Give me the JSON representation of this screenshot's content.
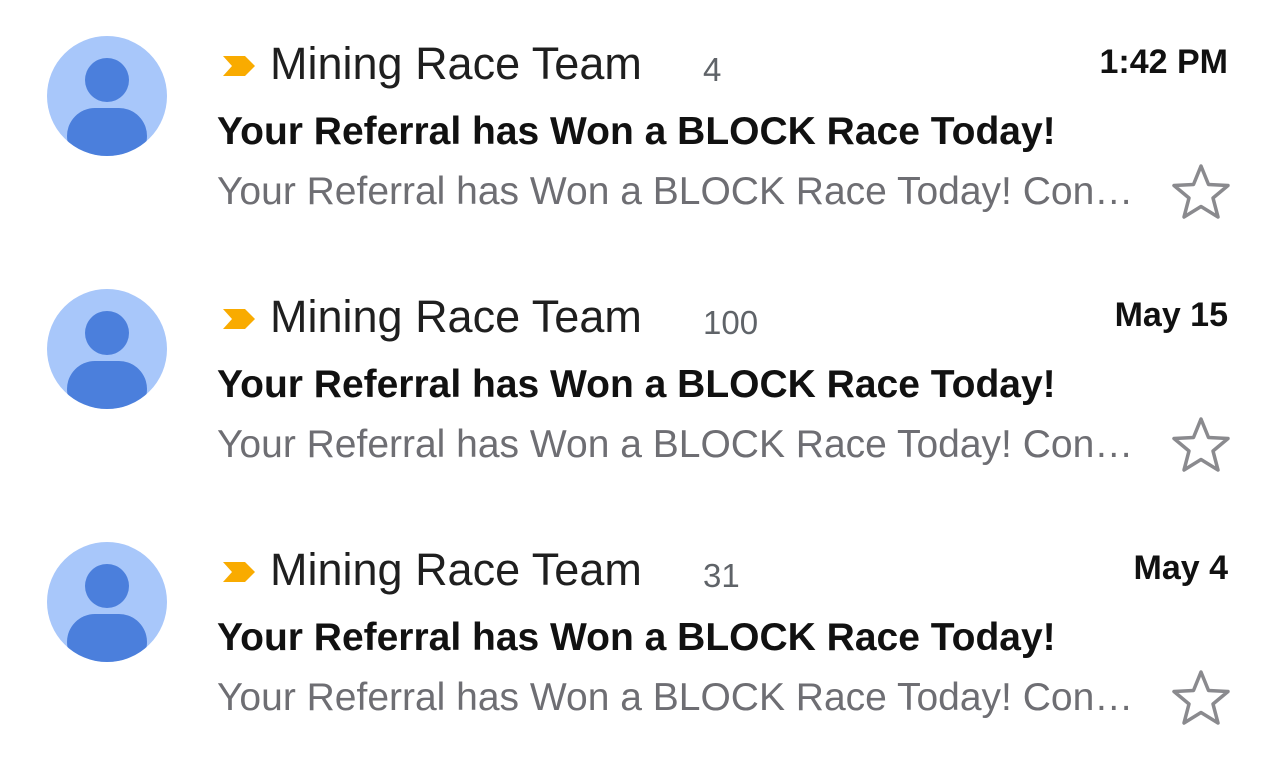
{
  "colors": {
    "avatar_bg": "#a8c7fa",
    "avatar_fg": "#4b7fdc",
    "important_marker": "#f9ab00",
    "star_outline": "#8a8a8e",
    "snippet_text": "#6e6e73",
    "count_text": "#5f6368"
  },
  "icons": {
    "avatar": "person-silhouette-icon",
    "important": "important-marker-icon",
    "star": "star-outline-icon"
  },
  "emails": [
    {
      "sender": "Mining Race Team",
      "count": "4",
      "time": "1:42 PM",
      "subject": "Your Referral has Won a BLOCK Race Today!",
      "snippet": "Your Referral has Won a BLOCK Race Today! Congratulations",
      "starred": false
    },
    {
      "sender": "Mining Race Team",
      "count": "100",
      "time": "May 15",
      "subject": "Your Referral has Won a BLOCK Race Today!",
      "snippet": "Your Referral has Won a BLOCK Race Today! Congratulations",
      "starred": false
    },
    {
      "sender": "Mining Race Team",
      "count": "31",
      "time": "May 4",
      "subject": "Your Referral has Won a BLOCK Race Today!",
      "snippet": "Your Referral has Won a BLOCK Race Today! Congratulations",
      "starred": false
    }
  ]
}
